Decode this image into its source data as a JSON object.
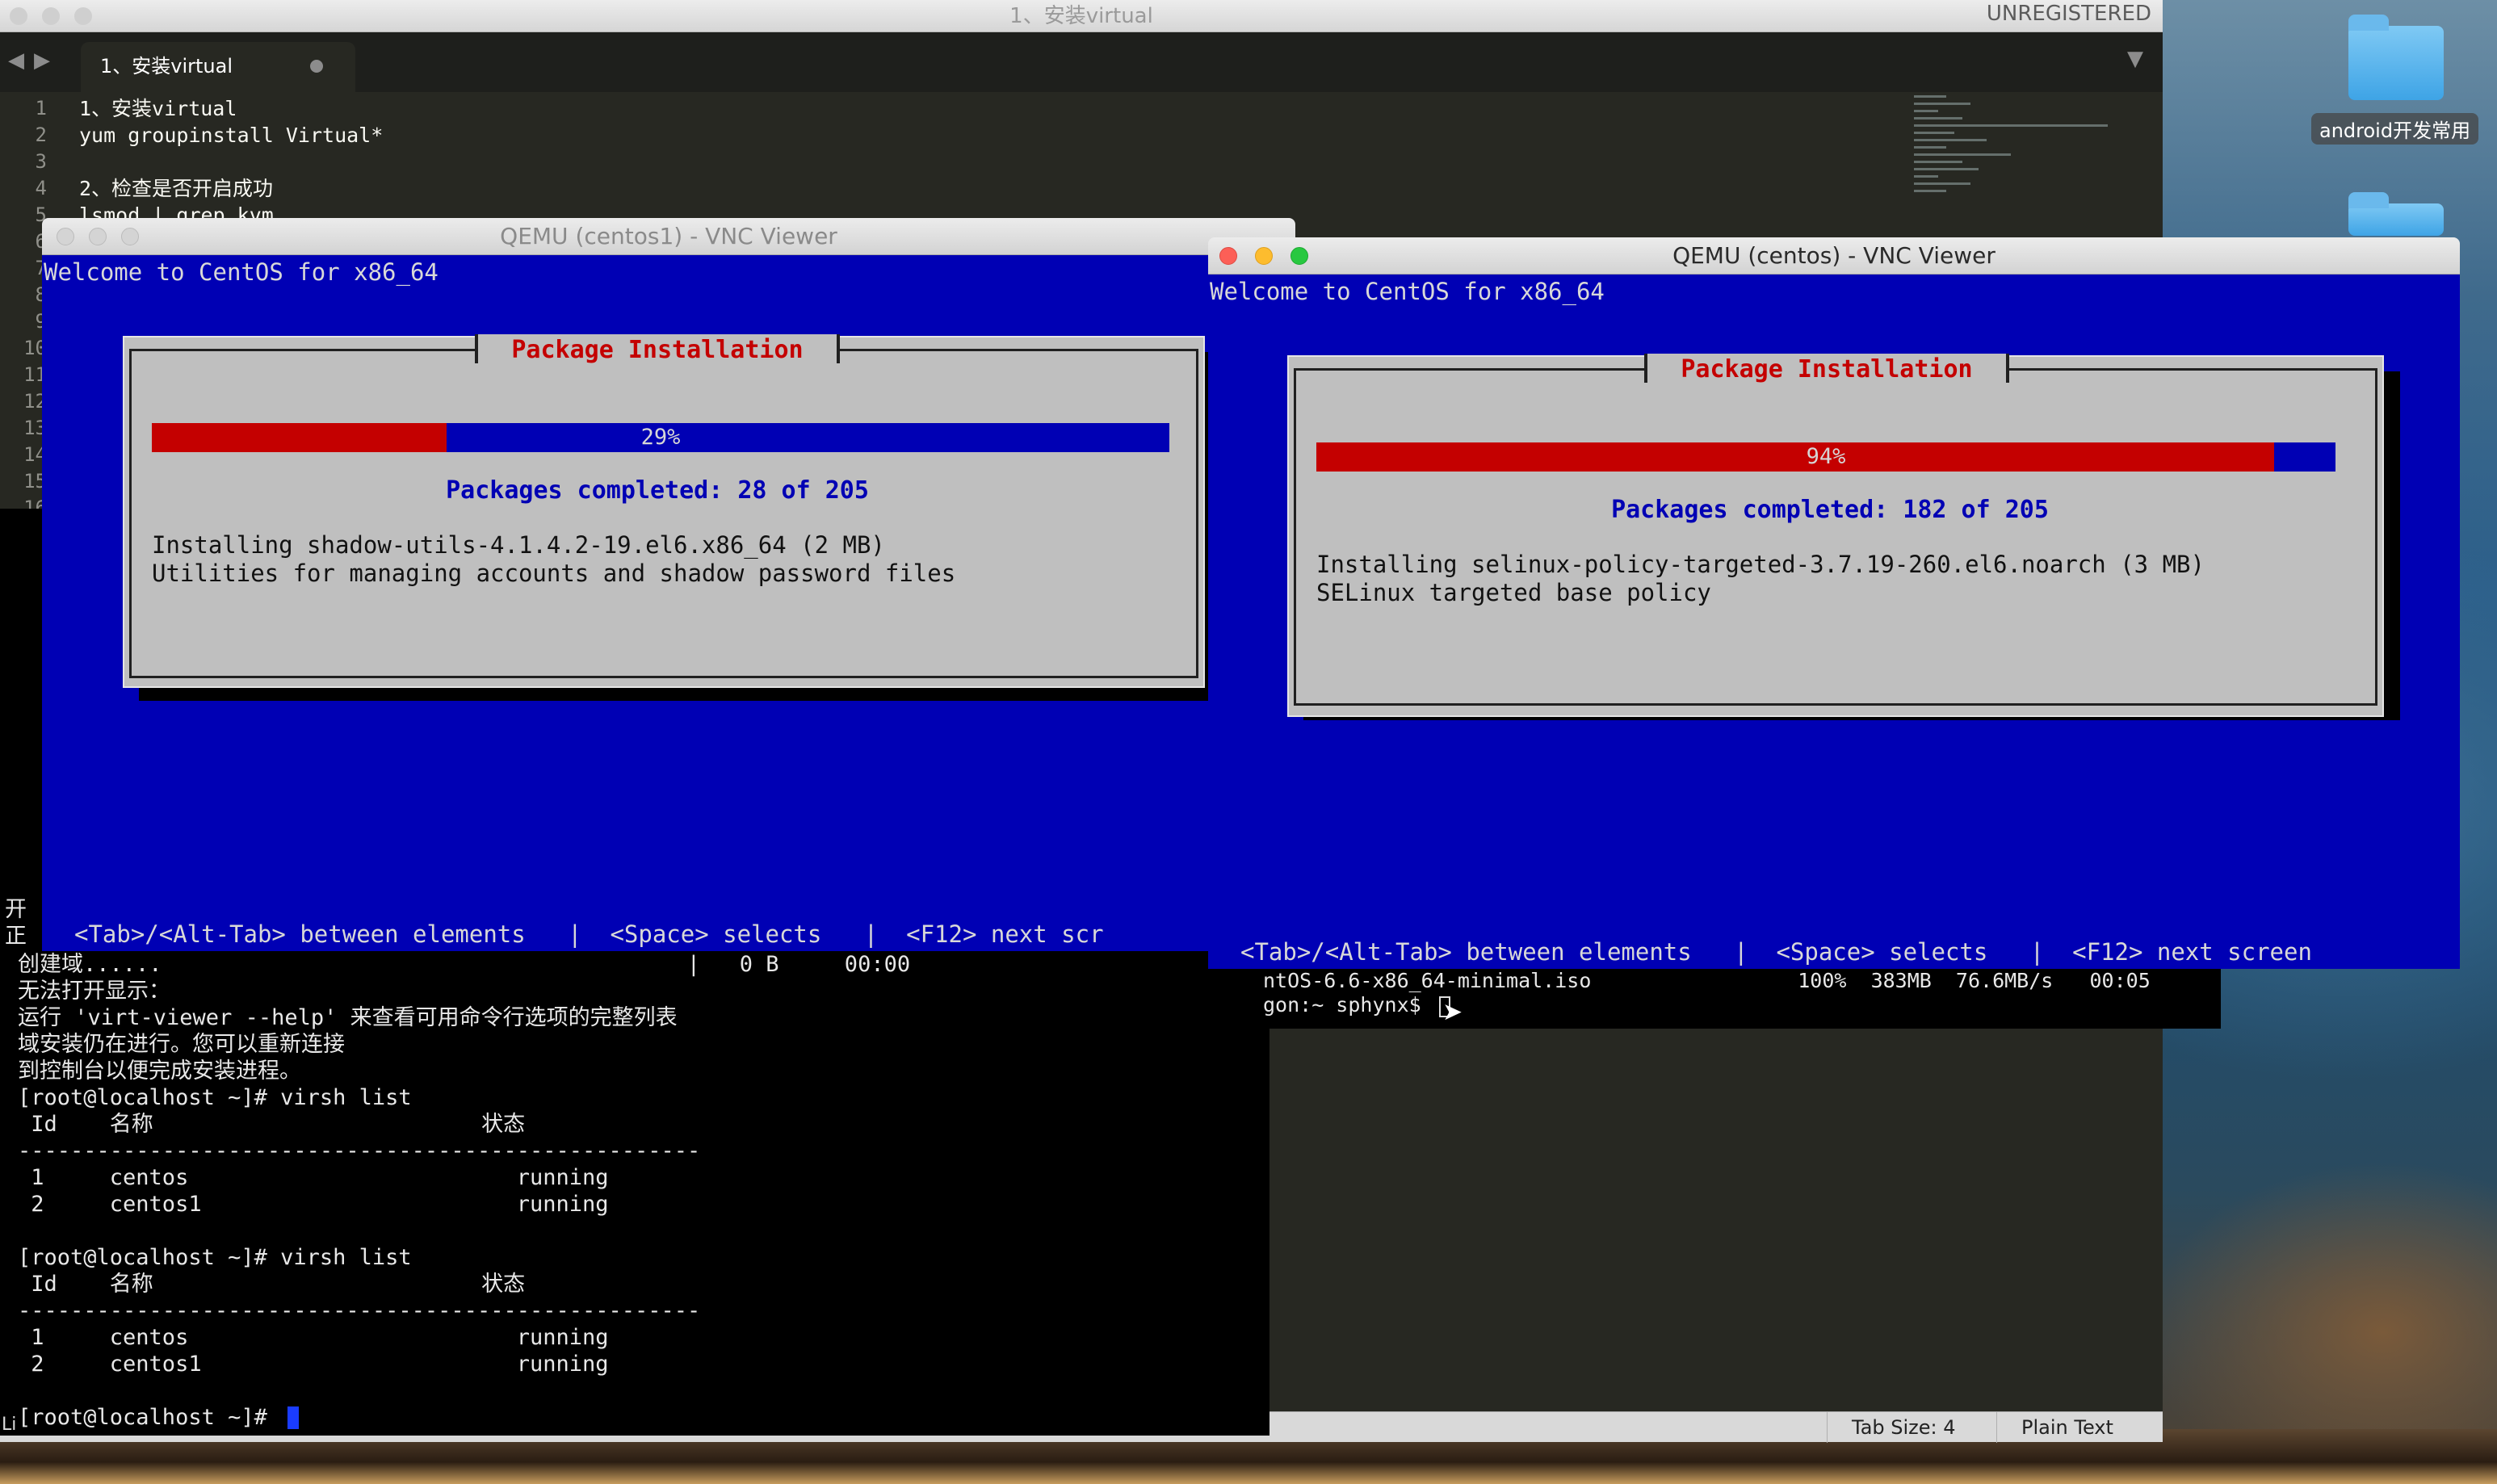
{
  "desktop": {
    "icon1_label": "android开发常用"
  },
  "editor": {
    "title": "1、安装virtual",
    "unregistered": "UNREGISTERED",
    "tab_label": "1、安装virtual",
    "nav_back": "◀",
    "nav_forward": "▶",
    "dropdown": "▼",
    "line_numbers": [
      "1",
      "2",
      "3",
      "4",
      "5",
      "6",
      "7",
      "8",
      "9",
      "10",
      "11",
      "12",
      "13",
      "14",
      "15",
      "16"
    ],
    "code_lines": [
      "1、安装virtual",
      "yum groupinstall Virtual*",
      "",
      "2、检查是否开启成功",
      "lsmod | grep kvm"
    ],
    "status": {
      "tab_size": "Tab Size: 4",
      "syntax": "Plain Text"
    }
  },
  "terminal": {
    "left_fragments": [
      "域",
      "到",
      "[r",
      "[r",
      " I",
      "--",
      " 1",
      "",
      "[r",
      "vi",
      "ss",
      "",
      "开",
      "正"
    ],
    "lines": [
      "创建域......                                        |   0 B     00:00",
      "无法打开显示：",
      "运行 'virt-viewer --help' 来查看可用命令行选项的完整列表",
      "域安装仍在进行。您可以重新连接",
      "到控制台以便完成安装进程。",
      "[root@localhost ~]# virsh list",
      " Id    名称                         状态",
      "----------------------------------------------------",
      " 1     centos                         running",
      " 2     centos1                        running",
      "",
      "[root@localhost ~]# virsh list",
      " Id    名称                         状态",
      "----------------------------------------------------",
      " 1     centos                         running",
      " 2     centos1                        running",
      "",
      "[root@localhost ~]# "
    ],
    "bottom_left": "Li"
  },
  "terminal2": {
    "line1": "ntOS-6.6-x86_64-minimal.iso                 100%  383MB  76.6MB/s   00:05",
    "line2": "gon:~ sphynx$ "
  },
  "vnc_left": {
    "title": "QEMU (centos1) - VNC Viewer",
    "welcome": "Welcome to CentOS for x86_64",
    "dialog_title": "Package Installation",
    "progress_label": "29%",
    "progress_value": 0.29,
    "packages_completed": "Packages completed: 28 of 205",
    "install_line1": "Installing shadow-utils-4.1.4.2-19.el6.x86_64 (2 MB)",
    "install_line2": "Utilities for managing accounts and shadow password files",
    "help": "<Tab>/<Alt-Tab> between elements   |  <Space> selects   |  <F12> next scr"
  },
  "vnc_right": {
    "title": "QEMU (centos) - VNC Viewer",
    "welcome": "Welcome to CentOS for x86_64",
    "dialog_title": "Package Installation",
    "progress_label": "94%",
    "progress_value": 0.94,
    "packages_completed": "Packages completed: 182 of 205",
    "install_line1": "Installing selinux-policy-targeted-3.7.19-260.el6.noarch (3 MB)",
    "install_line2": "SELinux targeted base policy",
    "help": "<Tab>/<Alt-Tab> between elements   |  <Space> selects   |  <F12> next screen"
  },
  "colors": {
    "vnc_blue": "#0000b4",
    "progress_red": "#c40000",
    "dialog_gray": "#bfbfbf",
    "editor_bg": "#272822"
  }
}
